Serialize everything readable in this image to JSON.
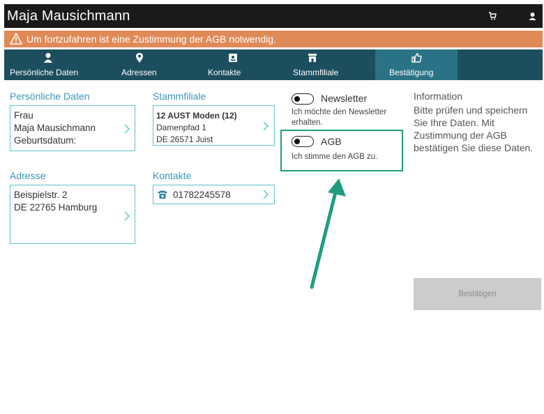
{
  "header": {
    "title": "Maja Mausichmann",
    "icons": [
      "cart-icon",
      "user-icon"
    ]
  },
  "warning": {
    "text": "Um fortzufahren ist eine Zustimmung der AGB notwendig.",
    "icon": "warning-icon"
  },
  "nav": {
    "tabs": [
      {
        "label": "Persönliche Daten",
        "icon": "person-icon",
        "active": false
      },
      {
        "label": "Adressen",
        "icon": "location-pin-icon",
        "active": false
      },
      {
        "label": "Kontakte",
        "icon": "contact-card-icon",
        "active": false
      },
      {
        "label": "Stammfiliale",
        "icon": "store-icon",
        "active": false
      },
      {
        "label": "Bestätigung",
        "icon": "thumbs-up-icon",
        "active": true
      }
    ]
  },
  "personal": {
    "title": "Persönliche Daten",
    "salutation": "Frau",
    "name": "Maja Mausichmann",
    "birthdate_label": "Geburtsdatum:"
  },
  "store": {
    "title": "Stammfiliale",
    "name": "12 AUST Moden (12)",
    "street": "Damenpfad 1",
    "city": "DE 26571 Juist"
  },
  "address": {
    "title": "Adresse",
    "street": "Beispielstr. 2",
    "city": "DE 22765 Hamburg"
  },
  "contacts": {
    "title": "Kontakte",
    "phone": "01782245578"
  },
  "newsletter": {
    "label": "Newsletter",
    "description": "Ich möchte den Newsletter erhalten.",
    "on": false
  },
  "agb": {
    "label": "AGB",
    "description": "Ich stimme den AGB zu.",
    "on": false
  },
  "info": {
    "title": "Information",
    "text": "Bitte prüfen und speichern Sie Ihre Daten. Mit Zustimmung der AGB bestätigen Sie diese Daten."
  },
  "actions": {
    "confirm_label": "Bestätigen"
  },
  "colors": {
    "nav_bg": "#1d4e5d",
    "nav_active": "#2a7386",
    "warning_bg": "#e08a58",
    "accent": "#3b95b5",
    "card_border": "#5cc0cf",
    "highlight": "#1f9e7f"
  }
}
